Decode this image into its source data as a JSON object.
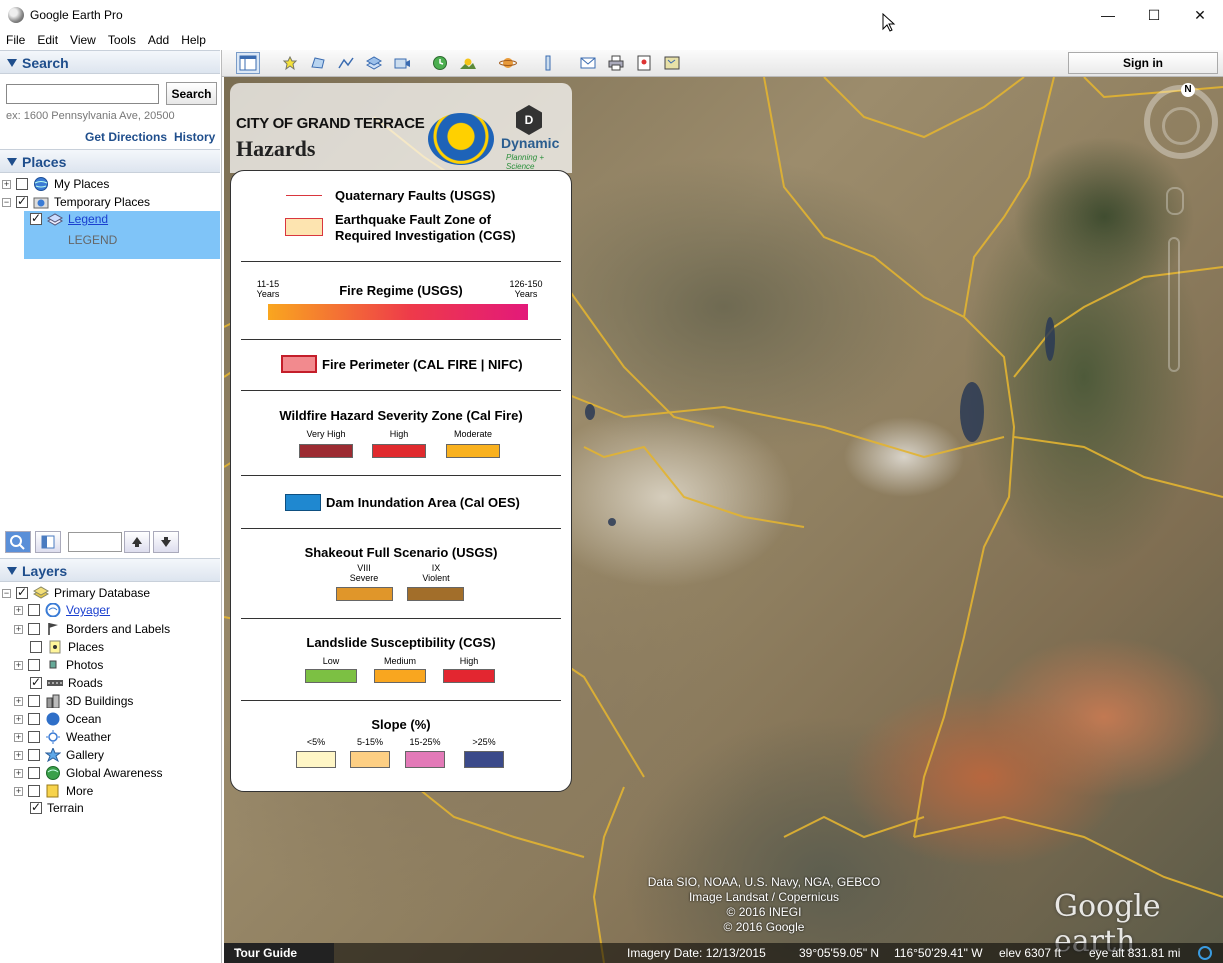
{
  "window": {
    "title": "Google Earth Pro",
    "minimize": "—",
    "maximize": "☐",
    "close": "✕"
  },
  "menu": [
    "File",
    "Edit",
    "View",
    "Tools",
    "Add",
    "Help"
  ],
  "search": {
    "header": "Search",
    "placeholder": "",
    "button": "Search",
    "example": "ex: 1600 Pennsylvania Ave, 20500",
    "get_directions": "Get Directions",
    "history": "History"
  },
  "places": {
    "header": "Places",
    "items": [
      {
        "label": "My Places",
        "checked": false
      },
      {
        "label": "Temporary Places",
        "checked": true
      },
      {
        "label": "Legend",
        "checked": true
      },
      {
        "label": "LEGEND"
      }
    ]
  },
  "layers": {
    "header": "Layers",
    "items": [
      {
        "label": "Primary Database",
        "checked": true
      },
      {
        "label": "Voyager",
        "checked": false
      },
      {
        "label": "Borders and Labels",
        "checked": false
      },
      {
        "label": "Places",
        "checked": false
      },
      {
        "label": "Photos",
        "checked": false
      },
      {
        "label": "Roads",
        "checked": true
      },
      {
        "label": "3D Buildings",
        "checked": false
      },
      {
        "label": "Ocean",
        "checked": false
      },
      {
        "label": "Weather",
        "checked": false
      },
      {
        "label": "Gallery",
        "checked": false
      },
      {
        "label": "Global Awareness",
        "checked": false
      },
      {
        "label": "More",
        "checked": false
      },
      {
        "label": "Terrain",
        "checked": true
      }
    ]
  },
  "toolbar": {
    "sign_in": "Sign in"
  },
  "map": {
    "attribution": [
      "Data SIO, NOAA, U.S. Navy, NGA, GEBCO",
      "Image Landsat / Copernicus",
      "© 2016 INEGI",
      "© 2016 Google"
    ],
    "logo": "Google earth",
    "compass_n": "N",
    "tour_guide": "Tour Guide",
    "imagery_date": "Imagery Date: 12/13/2015",
    "lat": "39°05'59.05\" N",
    "lon": "116°50'29.41\" W",
    "elev": "elev  6307 ft",
    "eye_alt": "eye alt 831.81 mi"
  },
  "legend": {
    "city": "CITY OF GRAND TERRACE",
    "title": "Hazards",
    "dps_mark": "D",
    "dps_name": "Dynamic",
    "dps_tag": "Planning + Science",
    "faults": "Quaternary Faults (USGS)",
    "fault_zone_1": "Earthquake Fault Zone of",
    "fault_zone_2": "Required Investigation (CGS)",
    "fire_regime": "Fire Regime (USGS)",
    "fire_regime_low_1": "11-15",
    "fire_regime_low_2": "Years",
    "fire_regime_high_1": "126-150",
    "fire_regime_high_2": "Years",
    "fire_perimeter": "Fire Perimeter (CAL FIRE | NIFC)",
    "wildfire_title": "Wildfire Hazard Severity Zone (Cal Fire)",
    "wildfire_classes": [
      "Very High",
      "High",
      "Moderate"
    ],
    "dam": "Dam Inundation Area (Cal OES)",
    "shakeout_title": "Shakeout Full Scenario (USGS)",
    "shakeout_classes": [
      [
        "VIII",
        "Severe"
      ],
      [
        "IX",
        "Violent"
      ]
    ],
    "landslide_title": "Landslide Susceptibility (CGS)",
    "landslide_classes": [
      "Low",
      "Medium",
      "High"
    ],
    "slope_title": "Slope (%)",
    "slope_classes": [
      "<5%",
      "5-15%",
      "15-25%",
      ">25%"
    ]
  },
  "colors": {
    "accent": "#1f4e8c",
    "selection": "#7fc4f8",
    "fault_line": "#d9363e",
    "fault_zone": "#fde4b0",
    "fire_perimeter": "#f28a8e",
    "wildfire": [
      "#9c2b32",
      "#e02a2e",
      "#f9b11f"
    ],
    "dam": "#1f88d0",
    "shakeout": [
      "#e0962a",
      "#a26e2a"
    ],
    "landslide": [
      "#7cc043",
      "#f9a61f",
      "#e32630"
    ],
    "slope": [
      "#fff6c6",
      "#fdcf84",
      "#e37ab8",
      "#3b4a8a"
    ],
    "roads": "#e3b431"
  }
}
